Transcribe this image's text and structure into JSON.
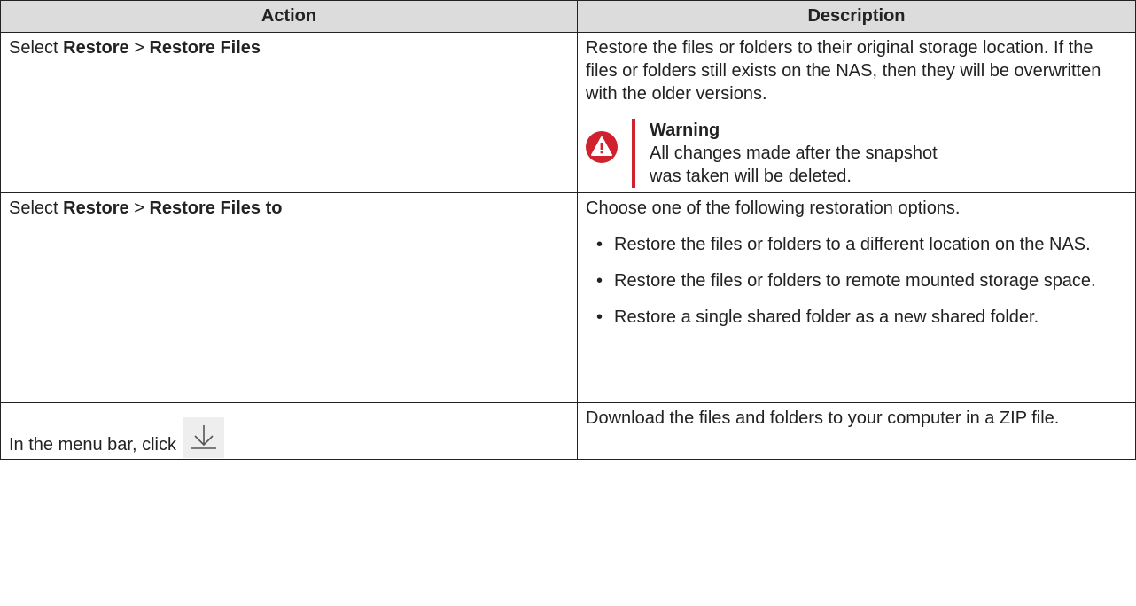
{
  "table": {
    "headers": {
      "action": "Action",
      "description": "Description"
    },
    "rows": [
      {
        "action": {
          "prefix": "Select ",
          "menu": "Restore",
          "sep": " > ",
          "item": "Restore Files"
        },
        "description": {
          "text": "Restore the files or folders to their original storage location. If the files or folders still exists on the NAS, then they will be overwritten with the older versions.",
          "warning": {
            "title": "Warning",
            "line1": "All changes made after the snapshot",
            "line2": "was taken will be deleted."
          }
        }
      },
      {
        "action": {
          "prefix": "Select ",
          "menu": "Restore",
          "sep": " > ",
          "item": "Restore Files to"
        },
        "description": {
          "intro": "Choose one of the following restoration options.",
          "options": [
            "Restore the files or folders to a different location on the NAS.",
            "Restore the files or folders to remote mounted storage space.",
            "Restore a single shared folder as a new shared folder."
          ]
        }
      },
      {
        "action": {
          "text": "In the menu bar, click",
          "icon": "download-icon"
        },
        "description": {
          "text": "Download the files and folders to your computer in a ZIP file."
        }
      }
    ]
  },
  "colors": {
    "header_bg": "#dcdcdc",
    "warning_accent": "#d0212e",
    "border": "#222222"
  }
}
